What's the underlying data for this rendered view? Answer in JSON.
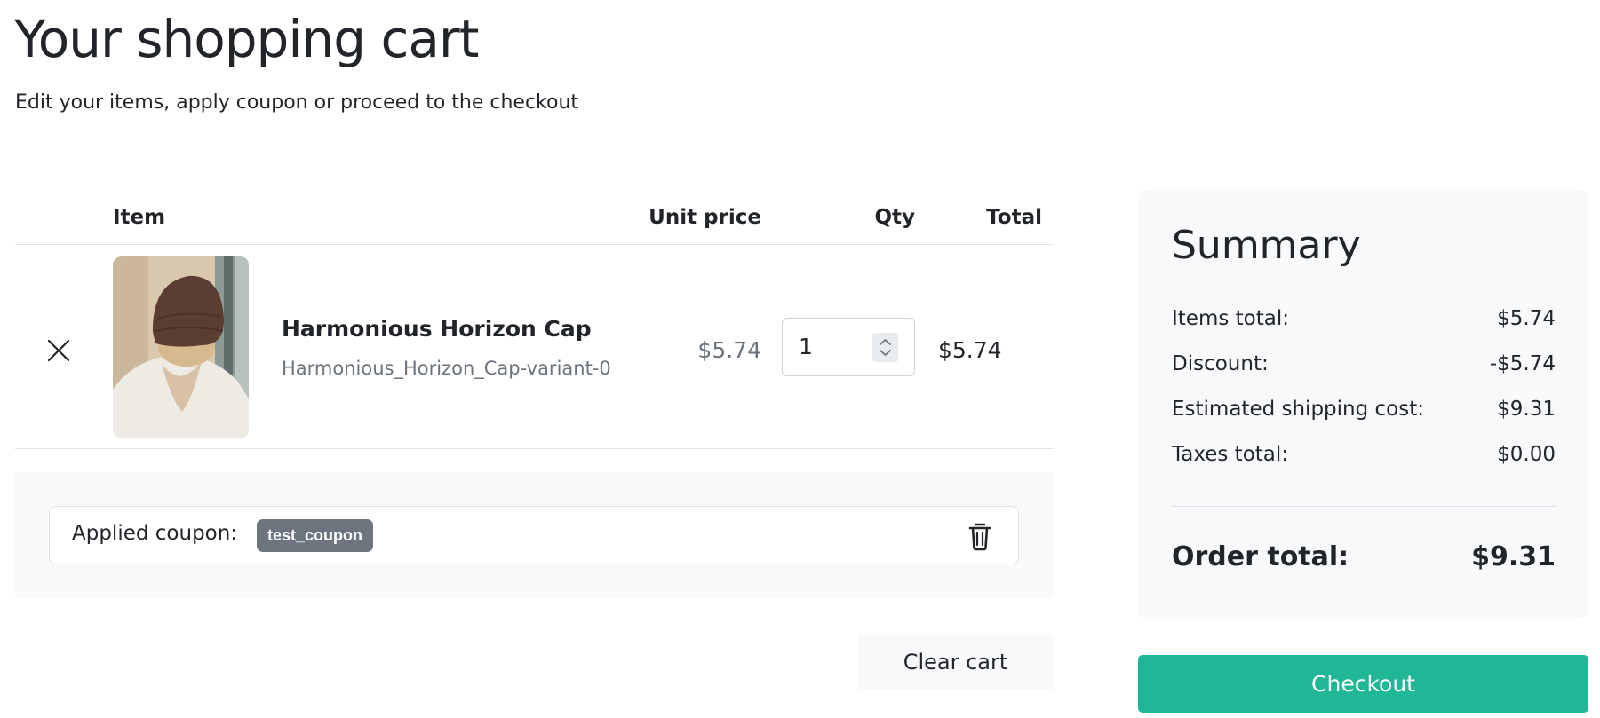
{
  "header": {
    "title": "Your shopping cart",
    "subtitle": "Edit your items, apply coupon or proceed to the checkout"
  },
  "cart": {
    "columns": {
      "item": "Item",
      "unit_price": "Unit price",
      "qty": "Qty",
      "total": "Total"
    },
    "items": [
      {
        "name": "Harmonious Horizon Cap",
        "variant": "Harmonious_Horizon_Cap-variant-0",
        "unit_price": "$5.74",
        "qty": "1",
        "total": "$5.74",
        "image_icon": "product-photo-beanie"
      }
    ],
    "coupon": {
      "label": "Applied coupon:",
      "code": "test_coupon"
    },
    "clear_label": "Clear cart"
  },
  "summary": {
    "title": "Summary",
    "rows": [
      {
        "label": "Items total:",
        "value": "$5.74"
      },
      {
        "label": "Discount:",
        "value": "-$5.74"
      },
      {
        "label": "Estimated shipping cost:",
        "value": "$9.31"
      },
      {
        "label": "Taxes total:",
        "value": "$0.00"
      }
    ],
    "order_total_label": "Order total:",
    "order_total_value": "$9.31"
  },
  "checkout_label": "Checkout",
  "colors": {
    "accent": "#20b796",
    "badge": "#6c757d",
    "panel": "#f8f9fa",
    "muted_text": "#6c757d"
  }
}
